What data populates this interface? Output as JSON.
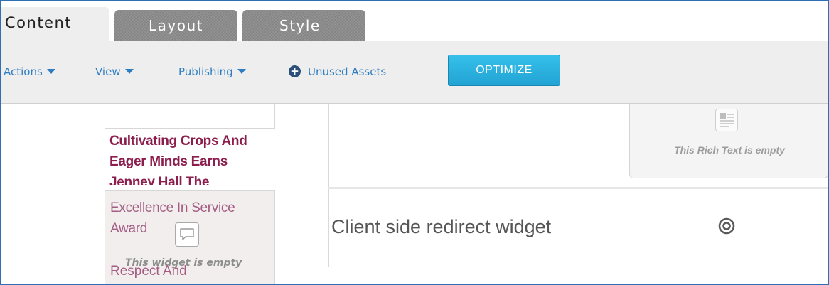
{
  "tabs": {
    "content": "Content",
    "layout": "Layout",
    "style": "Style"
  },
  "toolbar": {
    "actions": "Actions",
    "view": "View",
    "publishing": "Publishing",
    "unused_assets": "Unused Assets",
    "optimize": "OPTIMIZE"
  },
  "left_column": {
    "title_lines": [
      "Cultivating Crops And",
      "Eager Minds Earns",
      "Jenney Hall The"
    ],
    "widget_lines": [
      "Excellence In Service",
      "Award"
    ],
    "widget_empty": "This widget is empty",
    "widget_bottom": "Respect And"
  },
  "main": {
    "rich_text_empty": "This Rich Text is empty",
    "redirect_label": "Client side redirect widget"
  },
  "colors": {
    "link": "#2e7dc1",
    "optimize_bg": "#22a3d4",
    "title_text": "#8c1e4d",
    "overlay_text": "#a35d83",
    "frame_border": "#2f6fb3"
  },
  "icons": {
    "unused_assets": "plus-circle-icon",
    "widget": "speech-bubble-icon",
    "rich_text": "rich-text-icon",
    "redirect": "target-icon",
    "dropdown": "caret-down-icon"
  }
}
